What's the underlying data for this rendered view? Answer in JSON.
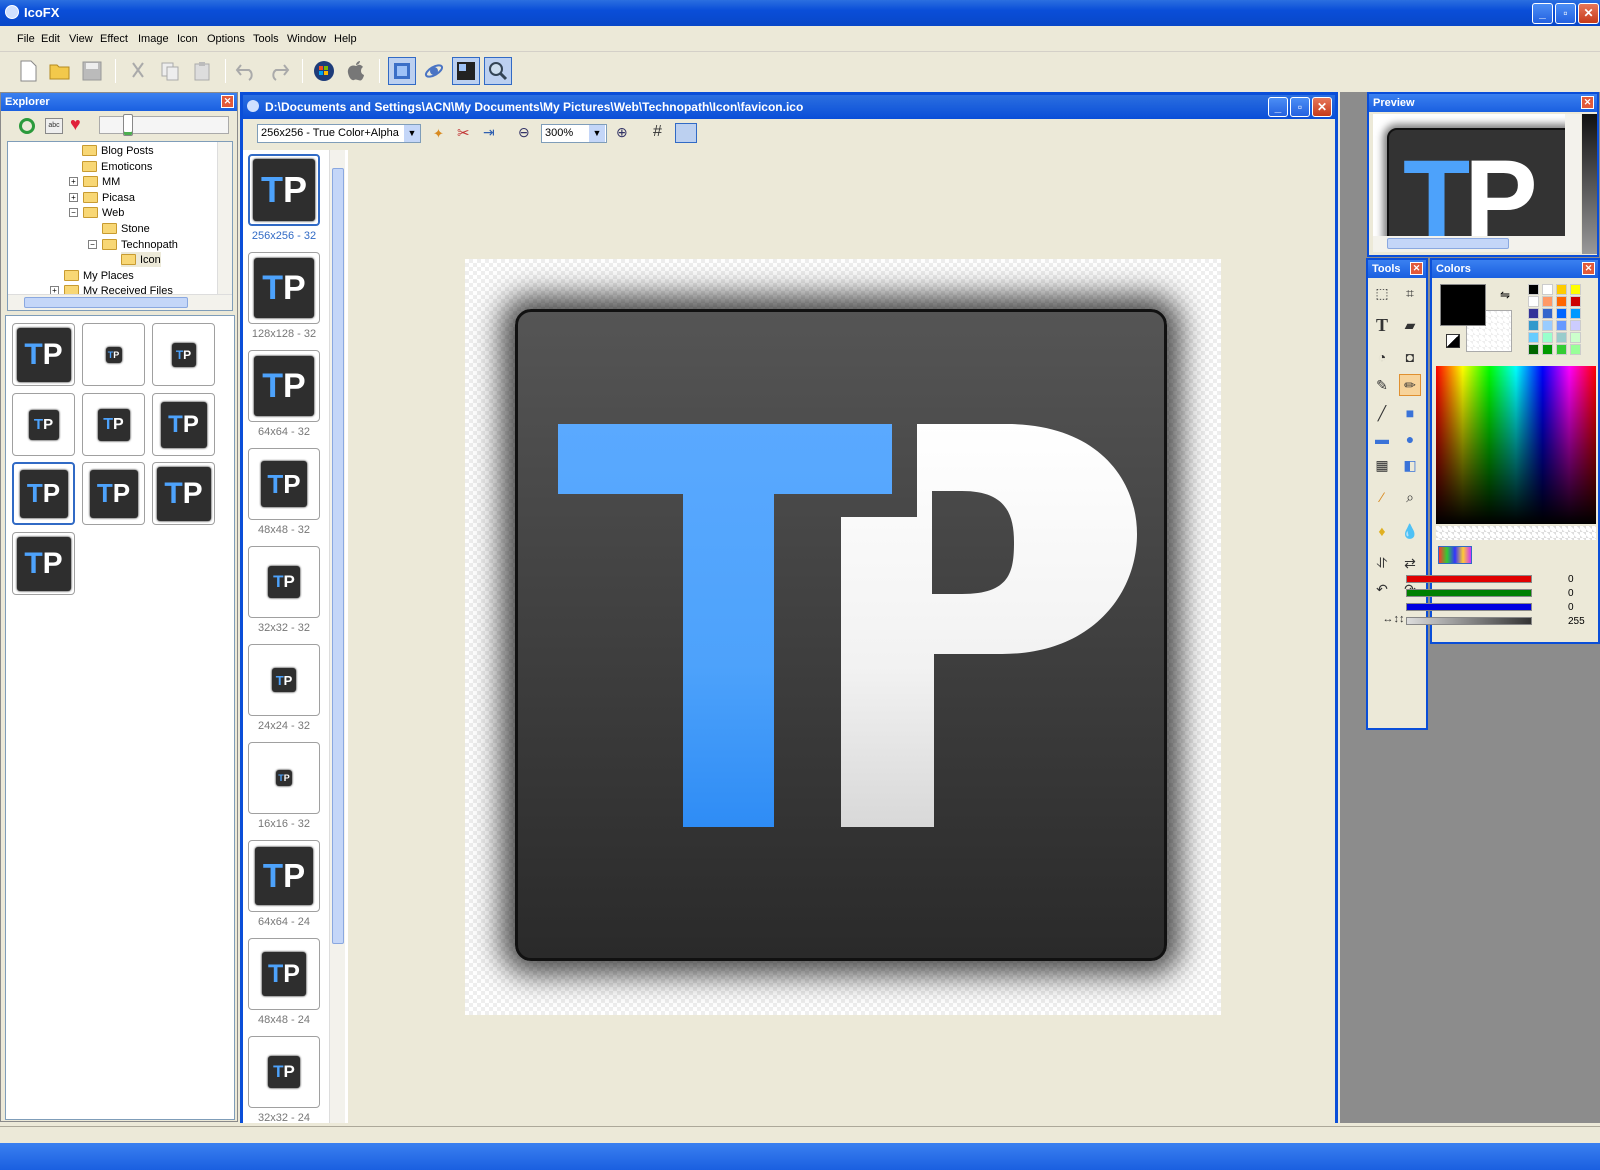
{
  "app": {
    "title": "IcoFX"
  },
  "window_controls": {
    "minimize": "_",
    "maximize": "▫",
    "close": "✕"
  },
  "menu": [
    "File",
    "Edit",
    "View",
    "Effect",
    "Image",
    "Icon",
    "Options",
    "Tools",
    "Window",
    "Help"
  ],
  "explorer": {
    "title": "Explorer",
    "tree": [
      {
        "label": "Blog Posts",
        "level": 3,
        "expander": ""
      },
      {
        "label": "Emoticons",
        "level": 3,
        "expander": ""
      },
      {
        "label": "MM",
        "level": 3,
        "expander": "+"
      },
      {
        "label": "Picasa",
        "level": 3,
        "expander": "+"
      },
      {
        "label": "Web",
        "level": 3,
        "expander": "−"
      },
      {
        "label": "Stone",
        "level": 4,
        "expander": ""
      },
      {
        "label": "Technopath",
        "level": 4,
        "expander": "−"
      },
      {
        "label": "Icon",
        "level": 5,
        "expander": ""
      },
      {
        "label": "My Places",
        "level": 2,
        "expander": ""
      },
      {
        "label": "My Received Files",
        "level": 2,
        "expander": "+"
      }
    ],
    "thumb_count": 10
  },
  "document": {
    "title": "D:\\Documents and Settings\\ACN\\My Documents\\My Pictures\\Web\\Technopath\\Icon\\favicon.ico",
    "format_select": "256x256 - True Color+Alpha",
    "zoom": "300%",
    "formats": [
      "256x256 - 32",
      "128x128 - 32",
      "64x64 - 32",
      "48x48 - 32",
      "32x32 - 32",
      "24x24 - 32",
      "16x16 - 32",
      "64x64 - 24",
      "48x48 - 24",
      "32x32 - 24"
    ],
    "icon_letters": {
      "left": "T",
      "right": "P"
    }
  },
  "preview": {
    "title": "Preview"
  },
  "tools": {
    "title": "Tools"
  },
  "colors": {
    "title": "Colors",
    "red": "0",
    "green": "0",
    "blue": "0",
    "alpha": "255",
    "primary_color": "#000000",
    "palette": [
      "#000000",
      "#ffffff",
      "#ffcc00",
      "#ffff00",
      "#ffffff",
      "#ff9966",
      "#ff6600",
      "#cc0000",
      "#333399",
      "#3366cc",
      "#0066ff",
      "#0099ff",
      "#3399cc",
      "#99ccff",
      "#6699ff",
      "#ccccff",
      "#66ccff",
      "#99ffcc",
      "#99cccc",
      "#ccffcc",
      "#006600",
      "#009900",
      "#33cc33",
      "#99ff99"
    ]
  },
  "accent": "#316ac5"
}
